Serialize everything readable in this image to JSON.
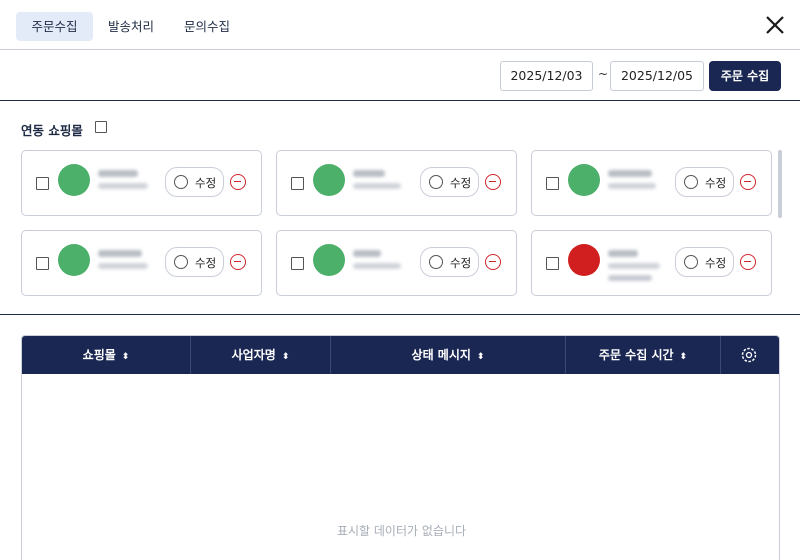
{
  "tabs": [
    {
      "label": "주문수집",
      "active": true
    },
    {
      "label": "발송처리",
      "active": false
    },
    {
      "label": "문의수집",
      "active": false
    }
  ],
  "date_range": {
    "start": "2025/12/03",
    "separator": "~",
    "end": "2025/12/05"
  },
  "collect_button": "주문 수집",
  "linked_malls": {
    "label": "연동 쇼핑몰",
    "cards": [
      {
        "logo_color": "#4caf6a",
        "edit_label": "수정"
      },
      {
        "logo_color": "#4caf6a",
        "edit_label": "수정"
      },
      {
        "logo_color": "#4caf6a",
        "edit_label": "수정"
      },
      {
        "logo_color": "#4caf6a",
        "edit_label": "수정"
      },
      {
        "logo_color": "#4caf6a",
        "edit_label": "수정"
      },
      {
        "logo_color": "#d11e1e",
        "edit_label": "수정"
      }
    ]
  },
  "table": {
    "columns": [
      "쇼핑몰",
      "사업자명",
      "상태 메시지",
      "주문 수집 시간"
    ],
    "empty_message": "표시할 데이터가 없습니다"
  },
  "colors": {
    "primary": "#1a2753",
    "remove": "#d0252b",
    "tab_active_bg": "#e4ebf8"
  },
  "icons": {
    "close": "close-icon",
    "edit": "pencil-icon",
    "remove": "minus-circle-icon",
    "settings": "gear-icon",
    "sort": "sort-icon"
  }
}
